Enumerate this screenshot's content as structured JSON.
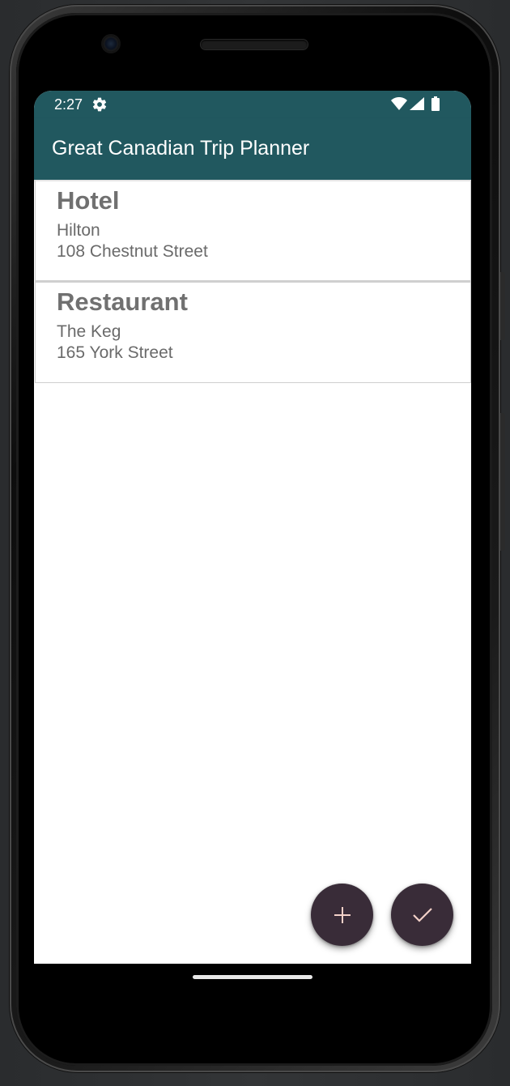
{
  "status_bar": {
    "time": "2:27",
    "icons": [
      "settings-icon",
      "wifi-icon",
      "cell-signal-icon",
      "battery-icon"
    ]
  },
  "app_bar": {
    "title": "Great Canadian Trip Planner"
  },
  "items": [
    {
      "category": "Hotel",
      "name": "Hilton",
      "address": "108 Chestnut Street"
    },
    {
      "category": "Restaurant",
      "name": "The Keg",
      "address": "165 York Street"
    }
  ],
  "fabs": {
    "add_icon": "plus-icon",
    "done_icon": "check-icon"
  },
  "colors": {
    "primary": "#21585f",
    "fab": "#392c38",
    "fab_icon": "#f3d1c8",
    "card_text": "#707070"
  }
}
